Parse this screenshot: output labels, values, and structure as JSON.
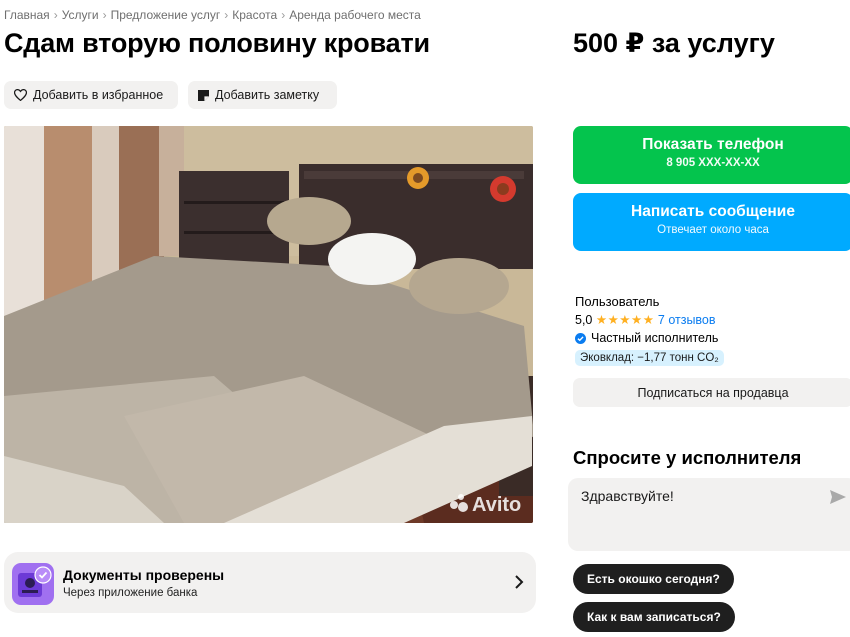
{
  "breadcrumbs": [
    "Главная",
    "Услуги",
    "Предложение услуг",
    "Красота",
    "Аренда рабочего места"
  ],
  "breadcrumb_separator": "›",
  "title": "Сдам вторую половину кровати",
  "price": "500 ₽ за услугу",
  "actions": {
    "favorite_label": "Добавить в избранное",
    "note_label": "Добавить заметку"
  },
  "photo": {
    "watermark": "Avito",
    "icon": "bedroom-photo"
  },
  "documents": {
    "title": "Документы проверены",
    "subtitle": "Через приложение банка"
  },
  "contact": {
    "phone_button_label": "Показать телефон",
    "phone_masked": "8 905 XXX-XX-XX",
    "message_button_label": "Написать сообщение",
    "message_button_sub": "Отвечает около часа",
    "phone_color": "#04c44d",
    "message_color": "#00aaff"
  },
  "seller": {
    "name": "Пользователь",
    "rating": "5,0",
    "stars": "★★★★★",
    "reviews": "7 отзывов",
    "type": "Частный исполнитель",
    "eco": "Эковклад: −1,77 тонн CO₂",
    "subscribe_label": "Подписаться на продавца"
  },
  "ask": {
    "title": "Спросите у исполнителя",
    "message": "Здравствуйте!",
    "quick_questions": [
      "Есть окошко сегодня?",
      "Как к вам записаться?"
    ]
  }
}
